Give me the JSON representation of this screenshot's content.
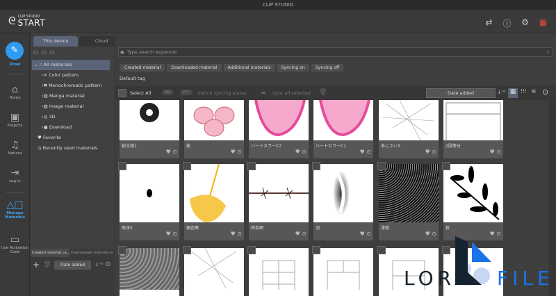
{
  "window": {
    "title": "CLIP STUDIO"
  },
  "header": {
    "logo_small": "CLIP STUDIO",
    "logo_big": "START"
  },
  "rail": [
    {
      "label": "Draw"
    },
    {
      "label": "Home"
    },
    {
      "label": "Projects"
    },
    {
      "label": "Notices"
    },
    {
      "label": "Log in"
    },
    {
      "label": "Manage Materials"
    },
    {
      "label": "Use Activation Code"
    }
  ],
  "left": {
    "tabs": [
      "This device",
      "Cloud"
    ],
    "tree": [
      "All materials",
      "Color pattern",
      "Monochromatic pattern",
      "Manga material",
      "Image material",
      "3D",
      "Download",
      "Favorite",
      "Recently used materials"
    ],
    "bottom_tabs": [
      "Created material ca...",
      "Downloaded material ca..."
    ],
    "sort": "Date added"
  },
  "main": {
    "search_placeholder": "Type search keywords",
    "chips": [
      "Created material",
      "Downloaded material",
      "Additional materials",
      "Syncing on",
      "Syncing off"
    ],
    "default_tag": "Default tag",
    "toolbar": {
      "select_all": "Select All",
      "on": "ON",
      "off": "OFF",
      "switch": "Switch syncing status",
      "sync": "Sync all selected",
      "sort": "Date added"
    },
    "row1": [
      "桜文様1",
      "桜",
      "ハートカラーC2",
      "ハートカラーC1",
      "あじさい3",
      "2段等分"
    ],
    "row2": [
      "飛沫5",
      "銀杏葉",
      "鉄条網",
      "羽",
      "漆喰",
      "枝"
    ]
  },
  "watermark": {
    "text": "LORAFILE"
  }
}
